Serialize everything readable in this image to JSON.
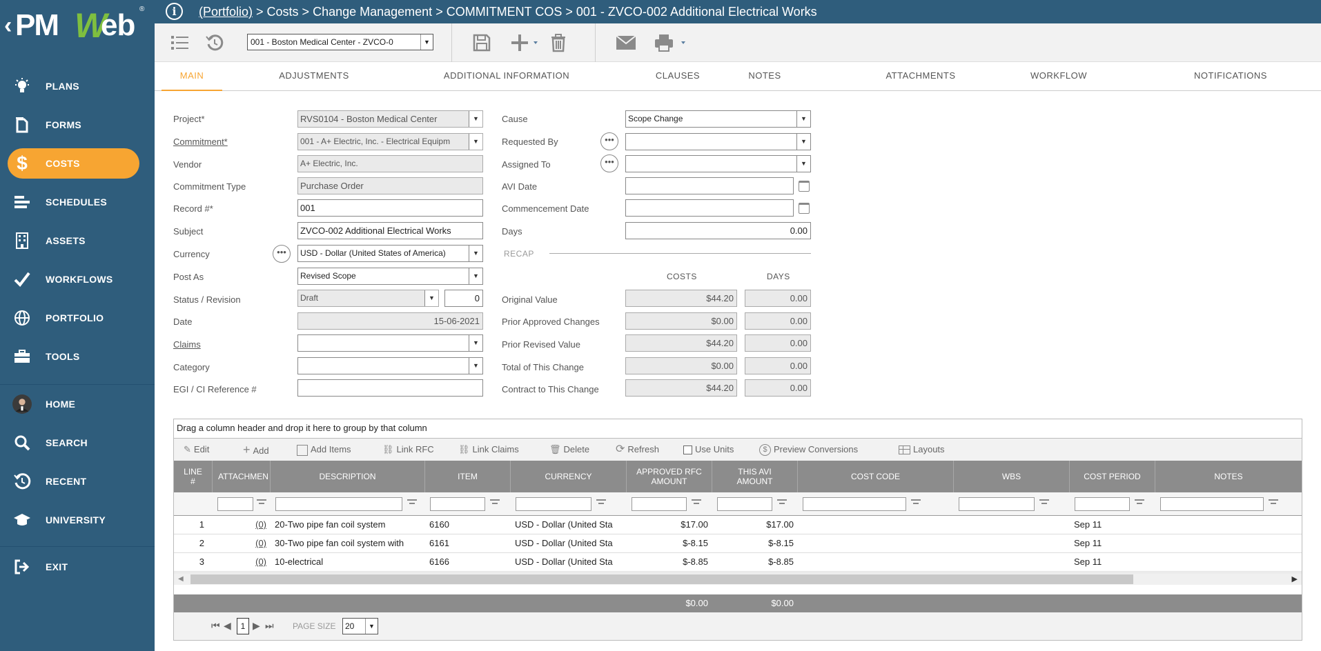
{
  "logo": {
    "text_left": "PM",
    "text_w": "W",
    "text_right": "eb"
  },
  "sidebar": {
    "items": [
      {
        "label": "PLANS",
        "icon": "lightbulb-icon"
      },
      {
        "label": "FORMS",
        "icon": "document-icon"
      },
      {
        "label": "COSTS",
        "icon": "dollar-icon",
        "active": true
      },
      {
        "label": "SCHEDULES",
        "icon": "gantt-icon"
      },
      {
        "label": "ASSETS",
        "icon": "building-icon"
      },
      {
        "label": "WORKFLOWS",
        "icon": "checkmark-icon"
      },
      {
        "label": "PORTFOLIO",
        "icon": "globe-icon"
      },
      {
        "label": "TOOLS",
        "icon": "toolbox-icon"
      },
      {
        "label": "HOME",
        "icon": "avatar"
      },
      {
        "label": "SEARCH",
        "icon": "search-icon"
      },
      {
        "label": "RECENT",
        "icon": "history-icon"
      },
      {
        "label": "UNIVERSITY",
        "icon": "graduation-cap-icon"
      },
      {
        "label": "EXIT",
        "icon": "exit-icon"
      }
    ],
    "active_color": "#f7a532",
    "bg_color": "#2f5d7c"
  },
  "header": {
    "breadcrumb_link": "(Portfolio)",
    "breadcrumb_rest": " > Costs > Change Management > COMMITMENT COS > 001 - ZVCO-002 Additional Electrical Works"
  },
  "toolbar": {
    "record_select": "001 - Boston Medical Center - ZVCO-0"
  },
  "tabs": [
    "MAIN",
    "ADJUSTMENTS",
    "ADDITIONAL INFORMATION",
    "CLAUSES",
    "NOTES",
    "ATTACHMENTS",
    "WORKFLOW",
    "NOTIFICATIONS"
  ],
  "form": {
    "project_label": "Project*",
    "project_value": "RVS0104 - Boston Medical Center",
    "commitment_label": "Commitment*",
    "commitment_value": "001 - A+ Electric, Inc. - Electrical Equipm",
    "vendor_label": "Vendor",
    "vendor_value": "A+ Electric, Inc.",
    "commitment_type_label": "Commitment Type",
    "commitment_type_value": "Purchase Order",
    "record_label": "Record #*",
    "record_value": "001",
    "subject_label": "Subject",
    "subject_value": "ZVCO-002 Additional Electrical Works",
    "currency_label": "Currency",
    "currency_value": "USD - Dollar (United States of America)",
    "post_as_label": "Post As",
    "post_as_value": "Revised Scope",
    "status_label": "Status / Revision",
    "status_value": "Draft",
    "revision_value": "0",
    "date_label": "Date",
    "date_value": "15-06-2021",
    "claims_label": "Claims",
    "claims_value": "",
    "category_label": "Category",
    "category_value": "",
    "egi_label": "EGI / CI Reference #",
    "egi_value": "",
    "cause_label": "Cause",
    "cause_value": "Scope Change",
    "requested_by_label": "Requested By",
    "requested_by_value": "",
    "assigned_to_label": "Assigned To",
    "assigned_to_value": "",
    "avi_date_label": "AVI Date",
    "avi_date_value": "",
    "commencement_label": "Commencement Date",
    "commencement_value": "",
    "days_label": "Days",
    "days_value": "0.00"
  },
  "recap": {
    "title": "RECAP",
    "costs_header": "COSTS",
    "days_header": "DAYS",
    "rows": [
      {
        "label": "Original Value",
        "cost": "$44.20",
        "days": "0.00"
      },
      {
        "label": "Prior Approved Changes",
        "cost": "$0.00",
        "days": "0.00"
      },
      {
        "label": "Prior Revised Value",
        "cost": "$44.20",
        "days": "0.00"
      },
      {
        "label": "Total of This Change",
        "cost": "$0.00",
        "days": "0.00"
      },
      {
        "label": "Contract to This Change",
        "cost": "$44.20",
        "days": "0.00"
      }
    ]
  },
  "grid": {
    "group_hint": "Drag a column header and drop it here to group by that column",
    "toolbar": {
      "edit": "Edit",
      "add": "Add",
      "add_items": "Add Items",
      "link_rfc": "Link RFC",
      "link_claims": "Link Claims",
      "delete": "Delete",
      "refresh": "Refresh",
      "use_units": "Use Units",
      "preview_conversions": "Preview Conversions",
      "layouts": "Layouts"
    },
    "columns": {
      "line_1": "LINE",
      "line_2": "#",
      "attachments": "ATTACHMEN",
      "description": "DESCRIPTION",
      "item": "ITEM",
      "currency": "CURRENCY",
      "approved_1": "APPROVED RFC",
      "approved_2": "AMOUNT",
      "this_avi_1": "THIS AVI",
      "this_avi_2": "AMOUNT",
      "cost_code": "COST CODE",
      "wbs": "WBS",
      "cost_period": "COST PERIOD",
      "notes": "NOTES"
    },
    "rows": [
      {
        "line": "1",
        "attach": "(0)",
        "description": "20-Two pipe fan coil system",
        "item": "6160",
        "currency": "USD - Dollar (United Sta",
        "approved": "$17.00",
        "this_avi": "$17.00",
        "cost_code": "",
        "wbs": "",
        "cost_period": "Sep 11",
        "notes": ""
      },
      {
        "line": "2",
        "attach": "(0)",
        "description": "30-Two pipe fan coil system with",
        "item": "6161",
        "currency": "USD - Dollar (United Sta",
        "approved": "$-8.15",
        "this_avi": "$-8.15",
        "cost_code": "",
        "wbs": "",
        "cost_period": "Sep 11",
        "notes": ""
      },
      {
        "line": "3",
        "attach": "(0)",
        "description": "10-electrical",
        "item": "6166",
        "currency": "USD - Dollar (United Sta",
        "approved": "$-8.85",
        "this_avi": "$-8.85",
        "cost_code": "",
        "wbs": "",
        "cost_period": "Sep 11",
        "notes": ""
      }
    ],
    "totals": {
      "approved": "$0.00",
      "this_avi": "$0.00"
    },
    "pager": {
      "page": "1",
      "page_size_label": "PAGE SIZE",
      "page_size": "20"
    }
  }
}
